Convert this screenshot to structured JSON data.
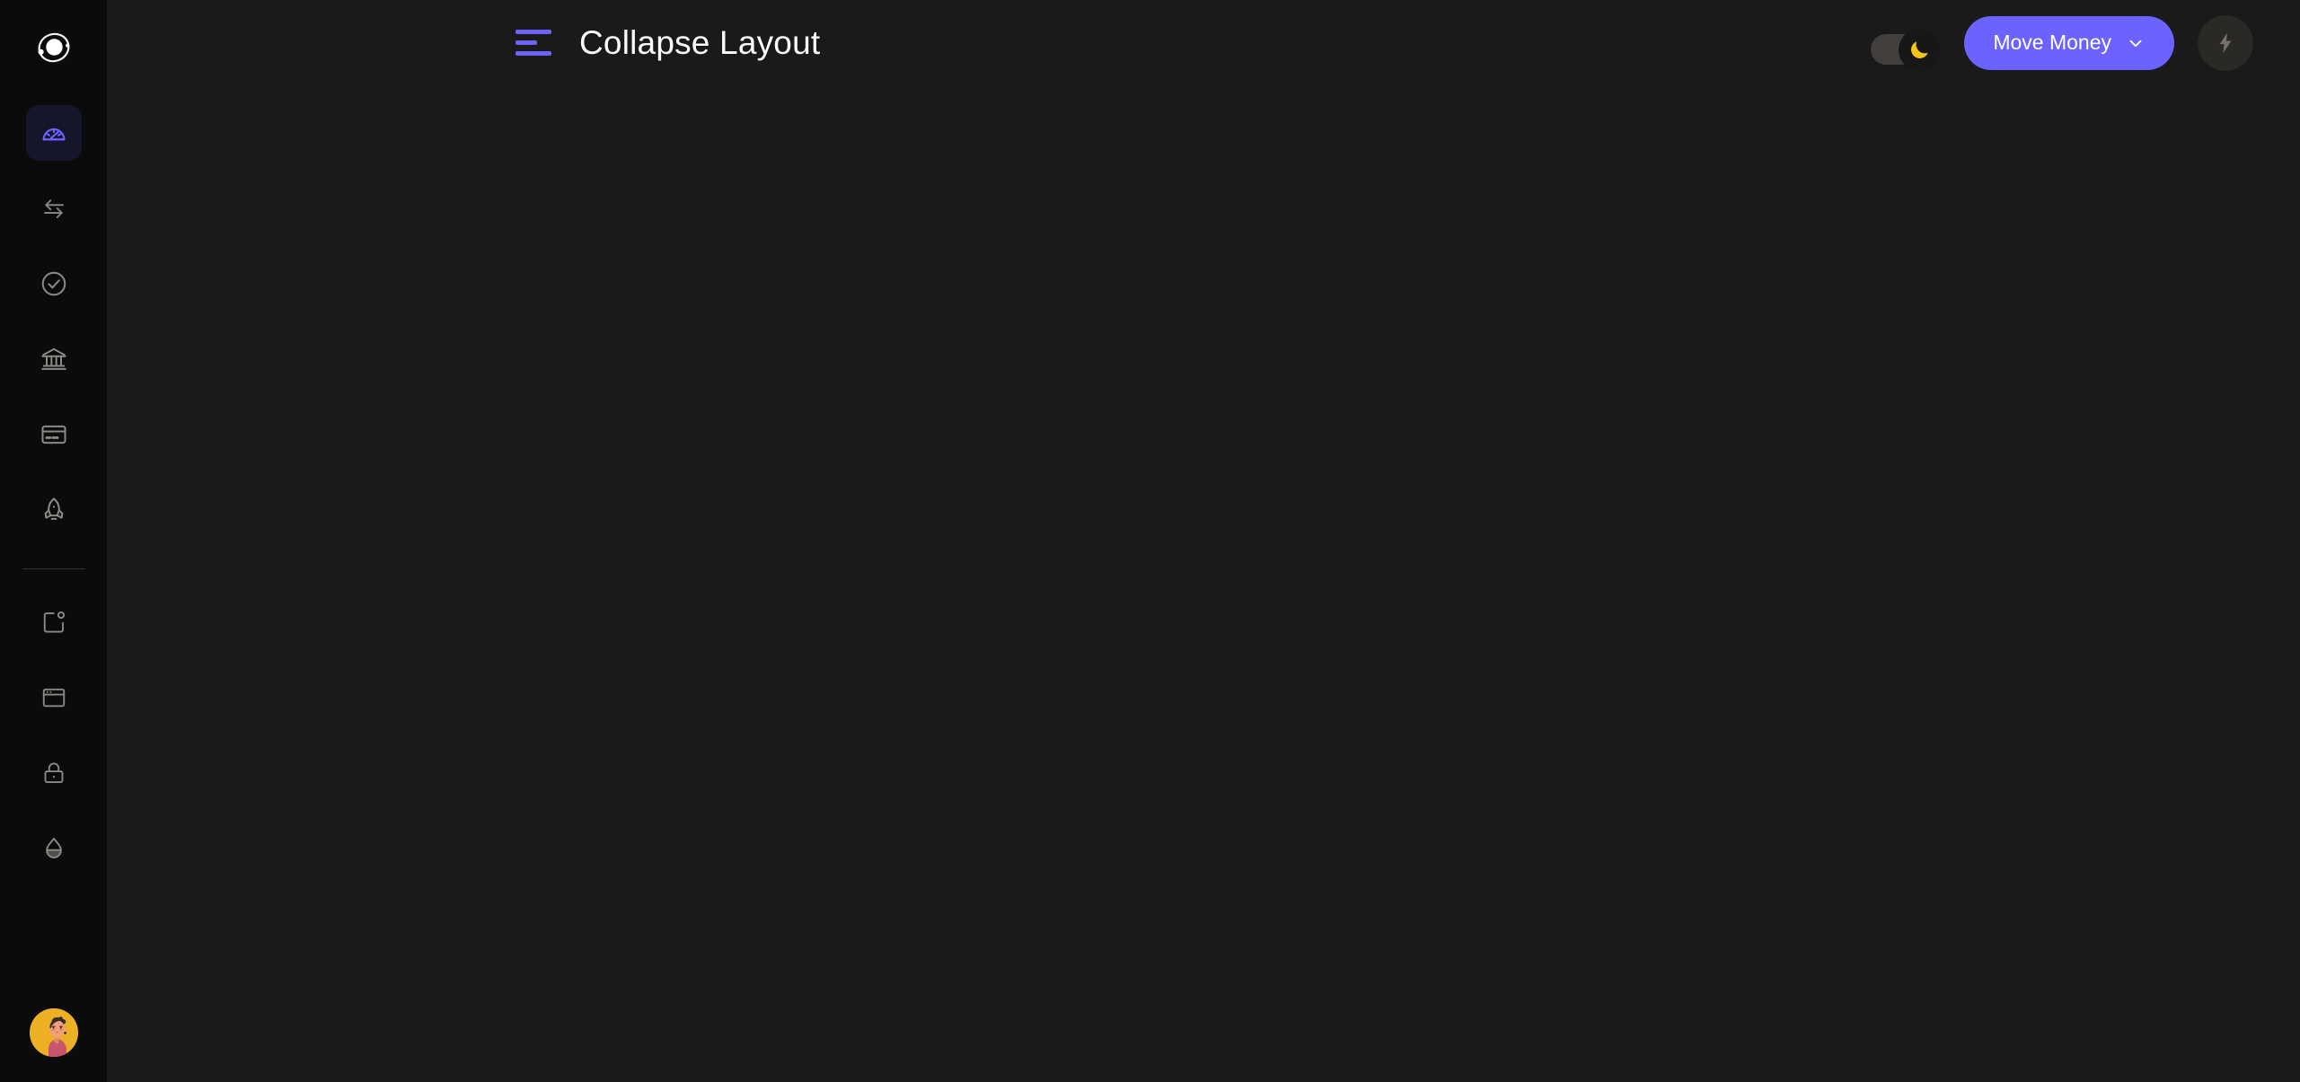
{
  "app": {
    "brand_icon": "orbit-logo-icon",
    "background": "#1a1a1a",
    "sidebar_background": "#0b0b0b",
    "accent": "#6c63ff"
  },
  "sidebar": {
    "brand_label": "",
    "items": [
      {
        "id": "dashboard",
        "icon": "gauge-icon",
        "label": "Dashboard",
        "active": true
      },
      {
        "id": "transfers",
        "icon": "arrows-exchange-icon",
        "label": "Transfers",
        "active": false
      },
      {
        "id": "approvals",
        "icon": "check-circle-icon",
        "label": "Approvals",
        "active": false
      },
      {
        "id": "accounts",
        "icon": "bank-icon",
        "label": "Accounts",
        "active": false
      },
      {
        "id": "cards",
        "icon": "credit-card-icon",
        "label": "Cards",
        "active": false
      },
      {
        "id": "launch",
        "icon": "rocket-icon",
        "label": "Launch",
        "active": false
      }
    ],
    "items_secondary": [
      {
        "id": "notifications",
        "icon": "square-dot-icon",
        "label": "Notifications",
        "active": false
      },
      {
        "id": "workspace",
        "icon": "browser-window-icon",
        "label": "Workspace",
        "active": false
      },
      {
        "id": "security",
        "icon": "lock-icon",
        "label": "Security",
        "active": false
      },
      {
        "id": "liquidity",
        "icon": "droplet-half-icon",
        "label": "Liquidity",
        "active": false
      }
    ],
    "avatar": {
      "icon": "avatar",
      "alt": "User avatar",
      "background": "#edb024"
    }
  },
  "topbar": {
    "menu_toggle_icon": "align-left-menu-icon",
    "title": "Collapse Layout",
    "dark_mode_toggle": {
      "icon": "moon-icon",
      "state": "on",
      "knob_color": "#f5c518",
      "track_color": "#423f3c"
    },
    "move_money_button": {
      "label": "Move Money",
      "chevron_icon": "chevron-down-icon",
      "color": "#6c63ff"
    },
    "quick_action_button": {
      "icon": "lightning-bolt-icon",
      "label": ""
    }
  },
  "content": {
    "body_text": ""
  }
}
